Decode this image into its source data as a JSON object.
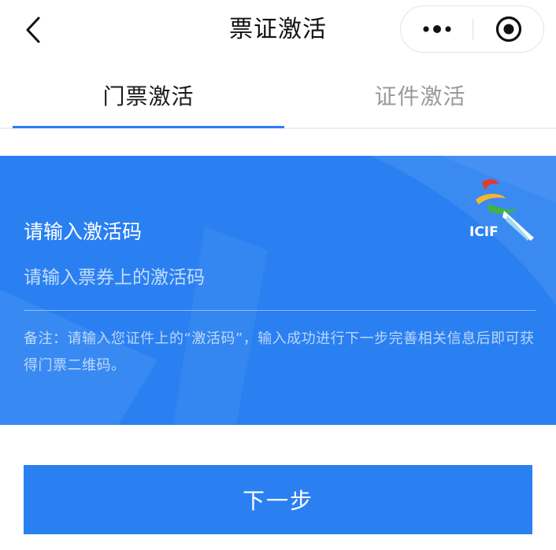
{
  "navbar": {
    "title": "票证激活",
    "back_icon": "chevron-left-icon",
    "more_icon": "more-dots-icon",
    "close_icon": "target-circle-icon"
  },
  "tabs": [
    {
      "label": "门票激活",
      "active": true
    },
    {
      "label": "证件激活",
      "active": false
    }
  ],
  "activation": {
    "label": "请输入激活码",
    "placeholder": "请输入票券上的激活码",
    "value": "",
    "note": "备注：请输入您证件上的“激活码”，输入成功进行下一步完善相关信息后即可获得门票二维码。",
    "logo_text": "ICIF"
  },
  "next_button": {
    "label": "下一步"
  },
  "colors": {
    "accent": "#2a80f1",
    "tab_active_text": "#1a1a1a",
    "tab_inactive_text": "#9a9a9a",
    "indicator": "#2d7df5"
  }
}
